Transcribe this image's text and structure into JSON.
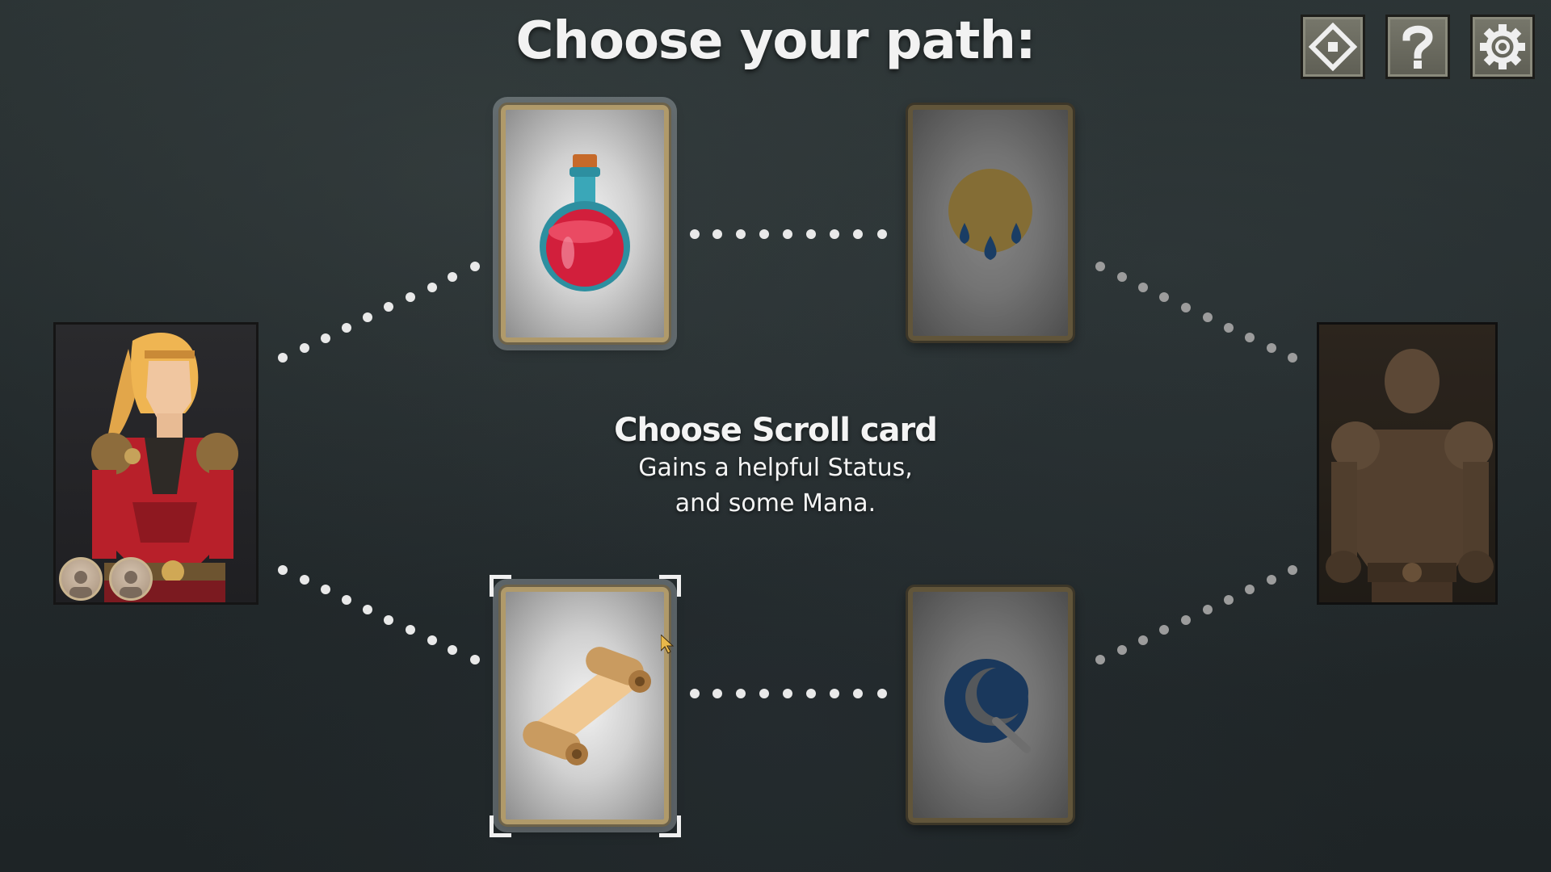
{
  "header": {
    "title": "Choose your path:"
  },
  "toolbar": {
    "buttons": [
      {
        "icon": "diamond-map-icon"
      },
      {
        "icon": "question-mark-icon"
      },
      {
        "icon": "gear-icon"
      }
    ]
  },
  "selection": {
    "heading": "Choose Scroll card",
    "description_line1": "Gains a helpful Status,",
    "description_line2": "and some Mana."
  },
  "cards": [
    {
      "id": "potion",
      "icon": "red-potion-icon",
      "state": "available"
    },
    {
      "id": "sweat",
      "icon": "gold-orb-drops-icon",
      "state": "locked"
    },
    {
      "id": "scroll",
      "icon": "scroll-icon",
      "state": "selected"
    },
    {
      "id": "moon-blade",
      "icon": "blue-crescent-axe-icon",
      "state": "locked"
    }
  ],
  "player": {
    "portrait": "red-armored-warrior-portrait",
    "party_tokens": 2
  },
  "enemy": {
    "portrait": "stone-golem-portrait"
  },
  "colors": {
    "card_frame": "#b09a6a",
    "background": "#252c2e",
    "text": "#f2f2f2"
  }
}
